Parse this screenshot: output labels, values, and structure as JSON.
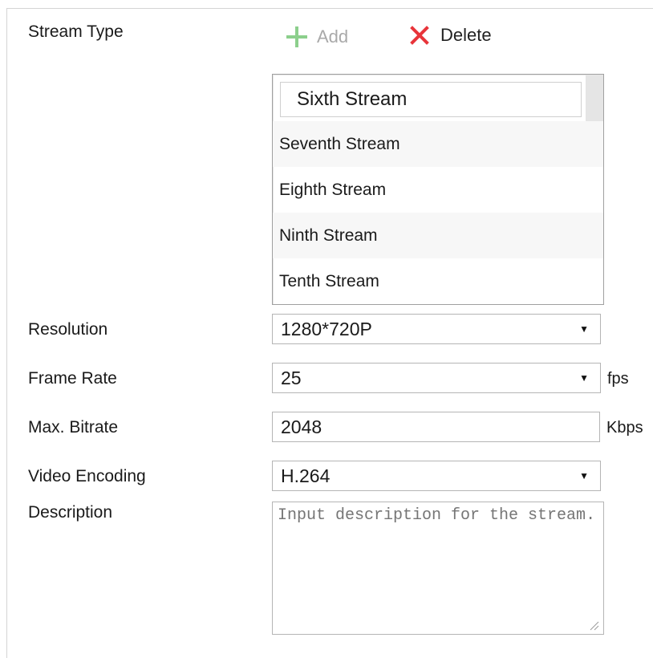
{
  "stream_type": {
    "label": "Stream Type",
    "add_label": "Add",
    "delete_label": "Delete",
    "stream_name_value": "Sixth Stream",
    "list_items": [
      "Seventh Stream",
      "Eighth Stream",
      "Ninth Stream",
      "Tenth Stream"
    ]
  },
  "resolution": {
    "label": "Resolution",
    "value": "1280*720P"
  },
  "frame_rate": {
    "label": "Frame Rate",
    "value": "25",
    "unit": "fps"
  },
  "max_bitrate": {
    "label": "Max. Bitrate",
    "value": "2048",
    "unit": "Kbps"
  },
  "video_encoding": {
    "label": "Video Encoding",
    "value": "H.264"
  },
  "description": {
    "label": "Description",
    "placeholder": "Input description for the stream."
  },
  "colors": {
    "add_icon": "#8ccf8c",
    "delete_icon": "#e8343a",
    "text": "#1a1a1a",
    "disabled_text": "#a9a9a9"
  },
  "icons": {
    "add": "plus-icon",
    "delete": "x-icon",
    "dropdown": "triangle-down-icon"
  }
}
